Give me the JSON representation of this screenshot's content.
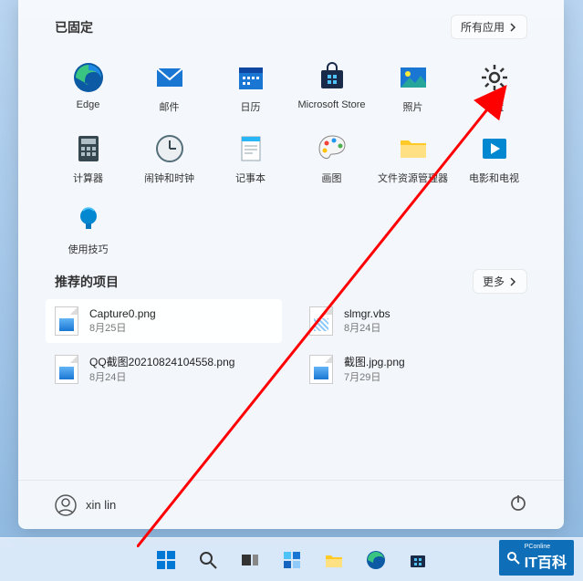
{
  "pinned": {
    "title": "已固定",
    "all_apps": "所有应用",
    "apps": [
      {
        "label": "Edge"
      },
      {
        "label": "邮件"
      },
      {
        "label": "日历"
      },
      {
        "label": "Microsoft Store"
      },
      {
        "label": "照片"
      },
      {
        "label": "设置"
      },
      {
        "label": "计算器"
      },
      {
        "label": "闹钟和时钟"
      },
      {
        "label": "记事本"
      },
      {
        "label": "画图"
      },
      {
        "label": "文件资源管理器"
      },
      {
        "label": "电影和电视"
      },
      {
        "label": "使用技巧"
      }
    ]
  },
  "recommended": {
    "title": "推荐的项目",
    "more": "更多",
    "items": [
      {
        "name": "Capture0.png",
        "date": "8月25日"
      },
      {
        "name": "slmgr.vbs",
        "date": "8月24日"
      },
      {
        "name": "QQ截图20210824104558.png",
        "date": "8月24日"
      },
      {
        "name": "截图.jpg.png",
        "date": "7月29日"
      }
    ]
  },
  "user": {
    "name": "xin lin"
  },
  "watermark": {
    "small": "PConline",
    "big": "IT百科"
  }
}
